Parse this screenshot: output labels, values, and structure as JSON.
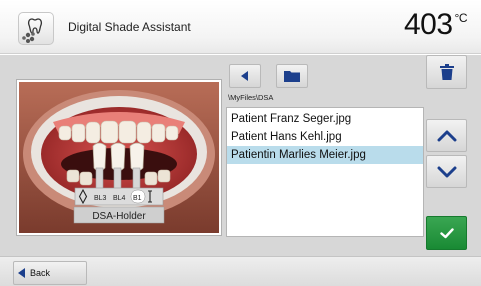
{
  "header": {
    "title": "Digital Shade Assistant",
    "temperature": "403",
    "temperature_unit": "°C",
    "app_icon": "tooth-shade-icon"
  },
  "photo": {
    "shade_tabs": [
      "BL3",
      "BL4",
      "B1"
    ],
    "holder_label": "DSA-Holder"
  },
  "toolbar": {
    "back_icon": "arrow-left-icon",
    "folder_icon": "folder-icon",
    "delete_icon": "trash-icon"
  },
  "file_browser": {
    "path": "\\MyFiles\\DSA",
    "files": [
      "Patient Franz Seger.jpg",
      "Patient Hans Kehl.jpg",
      "Patientin Marlies Meier.jpg"
    ],
    "selected_index": 2
  },
  "side_buttons": {
    "scroll_up_icon": "chevron-up-icon",
    "scroll_down_icon": "chevron-down-icon",
    "confirm_icon": "check-icon"
  },
  "footer": {
    "back_label": "Back"
  },
  "colors": {
    "accent_blue": "#1c3f8c",
    "confirm_green": "#22923a",
    "selection": "#b9dceb"
  }
}
